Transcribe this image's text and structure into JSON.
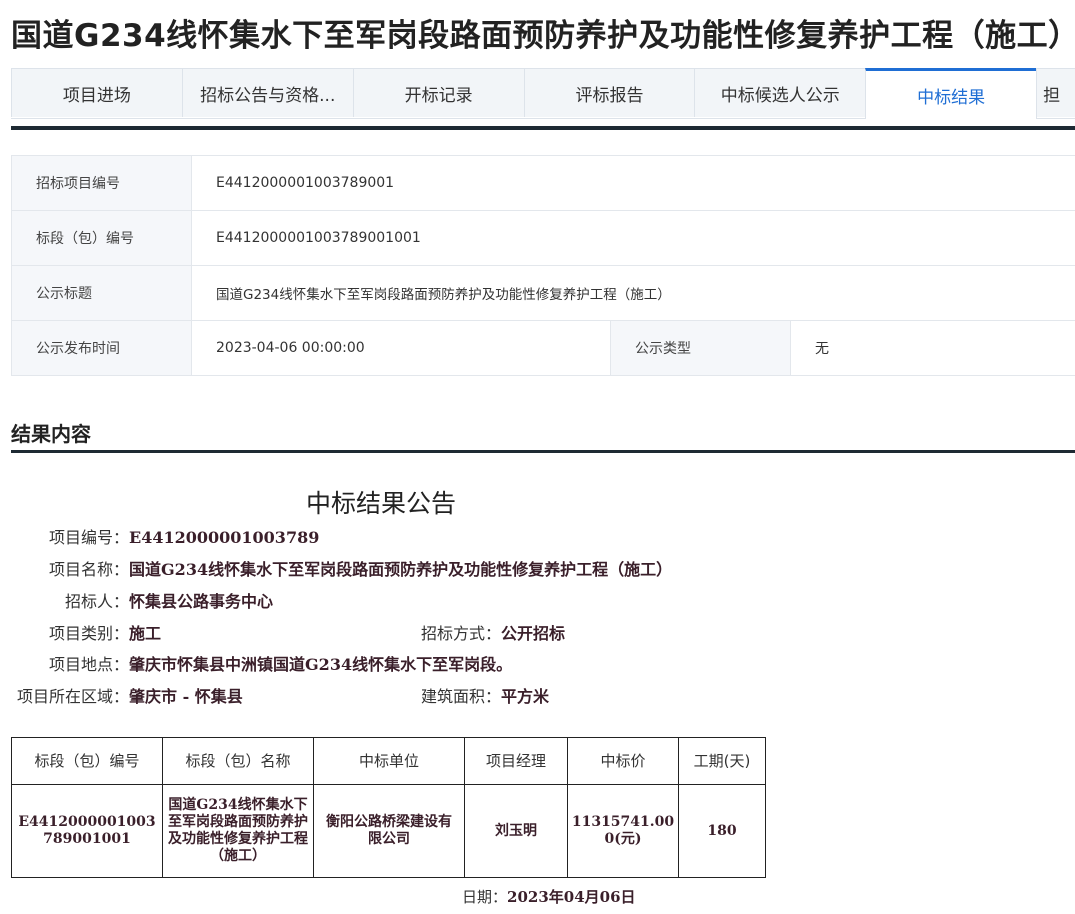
{
  "page_title": "国道G234线怀集水下至军岗段路面预防养护及功能性修复养护工程（施工）",
  "tabs": [
    {
      "label": "项目进场"
    },
    {
      "label": "招标公告与资格..."
    },
    {
      "label": "开标记录"
    },
    {
      "label": "评标报告"
    },
    {
      "label": "中标候选人公示"
    },
    {
      "label": "中标结果",
      "active": true
    },
    {
      "label": "担"
    }
  ],
  "info": {
    "project_no_label": "招标项目编号",
    "project_no": "E4412000001003789001",
    "section_no_label": "标段（包）编号",
    "section_no": "E4412000001003789001001",
    "notice_title_label": "公示标题",
    "notice_title": "国道G234线怀集水下至军岗段路面预防养护及功能性修复养护工程（施工）",
    "publish_time_label": "公示发布时间",
    "publish_time": "2023-04-06 00:00:00",
    "notice_type_label": "公示类型",
    "notice_type": "无"
  },
  "result_section_title": "结果内容",
  "notice": {
    "heading": "中标结果公告",
    "fields": {
      "project_code_label": "项目编号：",
      "project_code": "E4412000001003789",
      "project_name_label": "项目名称：",
      "project_name": "国道G234线怀集水下至军岗段路面预防养护及功能性修复养护工程（施工）",
      "tenderer_label": "招标人：",
      "tenderer": "怀集县公路事务中心",
      "category_label": "项目类别：",
      "category": "施工",
      "method_label": "招标方式：",
      "method": "公开招标",
      "location_label": "项目地点：",
      "location": "肇庆市怀集县中洲镇国道G234线怀集水下至军岗段。",
      "region_label": "项目所在区域：",
      "region": "肇庆市 - 怀集县",
      "area_label": "建筑面积：",
      "area": "平方米"
    },
    "table": {
      "headers": [
        "标段（包）编号",
        "标段（包）名称",
        "中标单位",
        "项目经理",
        "中标价",
        "工期(天)"
      ],
      "row": {
        "code": "E4412000001003789001001",
        "name": "国道G234线怀集水下至军岗段路面预防养护及功能性修复养护工程（施工）",
        "winner": "衡阳公路桥梁建设有限公司",
        "manager": "刘玉明",
        "price": "11315741.000(元)",
        "duration": "180"
      }
    },
    "date_label": "日期：",
    "date": "2023年04月06日"
  }
}
